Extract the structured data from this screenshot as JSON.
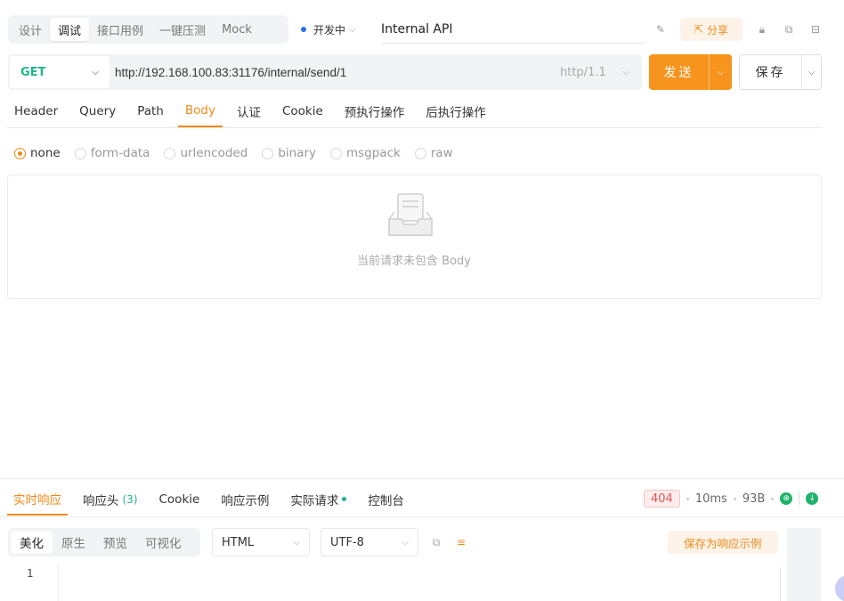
{
  "mode_tabs": [
    {
      "label": "设计"
    },
    {
      "label": "调试"
    },
    {
      "label": "接口用例"
    },
    {
      "label": "一键压测"
    },
    {
      "label": "Mock"
    }
  ],
  "status": {
    "label": "开发中",
    "color": "#2b6ff0"
  },
  "api_name": "Internal API",
  "share_label": "分享",
  "request": {
    "method": "GET",
    "url": "http://192.168.100.83:31176/internal/send/1",
    "protocol": "http/1.1"
  },
  "send_label": "发送",
  "save_label": "保存",
  "request_tabs": [
    {
      "label": "Header"
    },
    {
      "label": "Query"
    },
    {
      "label": "Path"
    },
    {
      "label": "Body"
    },
    {
      "label": "认证"
    },
    {
      "label": "Cookie"
    },
    {
      "label": "预执行操作"
    },
    {
      "label": "后执行操作"
    }
  ],
  "body_types": [
    {
      "label": "none"
    },
    {
      "label": "form-data"
    },
    {
      "label": "urlencoded"
    },
    {
      "label": "binary"
    },
    {
      "label": "msgpack"
    },
    {
      "label": "raw"
    }
  ],
  "empty_body_text": "当前请求未包含 Body",
  "response": {
    "tabs": [
      {
        "label": "实时响应"
      },
      {
        "label": "响应头",
        "count": "(3)"
      },
      {
        "label": "Cookie"
      },
      {
        "label": "响应示例"
      },
      {
        "label": "实际请求"
      },
      {
        "label": "控制台"
      }
    ],
    "status_code": "404",
    "time": "10ms",
    "size": "93B",
    "format_tabs": [
      {
        "label": "美化"
      },
      {
        "label": "原生"
      },
      {
        "label": "预览"
      },
      {
        "label": "可视化"
      }
    ],
    "content_type": "HTML",
    "encoding": "UTF-8",
    "save_example_label": "保存为响应示例",
    "line_number": "1"
  },
  "colors": {
    "accent": "#f7941d",
    "method_get": "#1fb58d",
    "error": "#e45656"
  }
}
